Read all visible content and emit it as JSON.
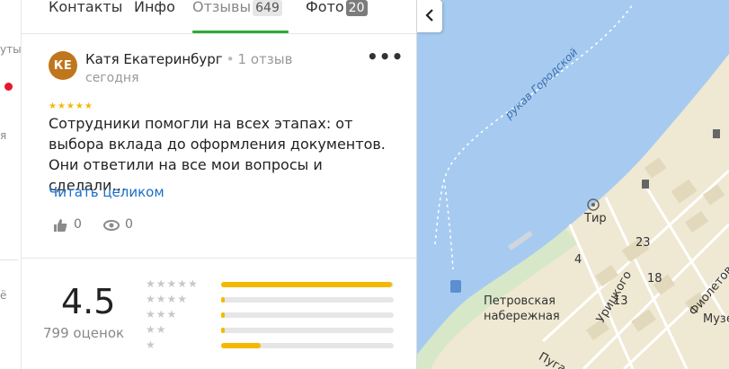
{
  "left_strip": {
    "fragments": [
      "уты",
      "я",
      "ё"
    ]
  },
  "tabs": [
    {
      "label": "Контакты",
      "count": ""
    },
    {
      "label": "Инфо",
      "count": ""
    },
    {
      "label": "Отзывы",
      "count": "649"
    },
    {
      "label": "Фото",
      "count": "20"
    }
  ],
  "review": {
    "avatar_initials": "КЕ",
    "author": "Катя Екатеринбург",
    "author_meta": "1 отзыв",
    "date": "сегодня",
    "rating": 5,
    "text": "Сотрудники помогли на всех этапах: от выбора вклада до оформления документов. Они ответили на все мои вопросы и сделали…",
    "read_more": "Читать целиком",
    "likes": "0",
    "views": "0"
  },
  "summary": {
    "average": "4.5",
    "votes_label": "799 оценок",
    "distribution": [
      {
        "stars": 5,
        "fraction": 0.99
      },
      {
        "stars": 4,
        "fraction": 0.02
      },
      {
        "stars": 3,
        "fraction": 0.02
      },
      {
        "stars": 2,
        "fraction": 0.02
      },
      {
        "stars": 1,
        "fraction": 0.23
      }
    ]
  },
  "map": {
    "labels": {
      "river": "рукав Городской",
      "tir": "Тир",
      "embankment_line1": "Петровская",
      "embankment_line2": "набережная",
      "street_uritskogo": "Урицкого",
      "street_fioletova": "Фиолетова",
      "street_pug": "Пуга",
      "museum": "Музе",
      "house_23": "23",
      "house_18": "18",
      "house_13": "13",
      "house_4": "4"
    },
    "colors": {
      "water": "#a7cbf0",
      "land": "#efe8d2",
      "park": "#d6e8c8"
    }
  },
  "colors": {
    "accent_green": "#2ea836",
    "link_blue": "#1a6ec8",
    "star_yellow": "#f5b800",
    "avatar": "#c0761c"
  }
}
